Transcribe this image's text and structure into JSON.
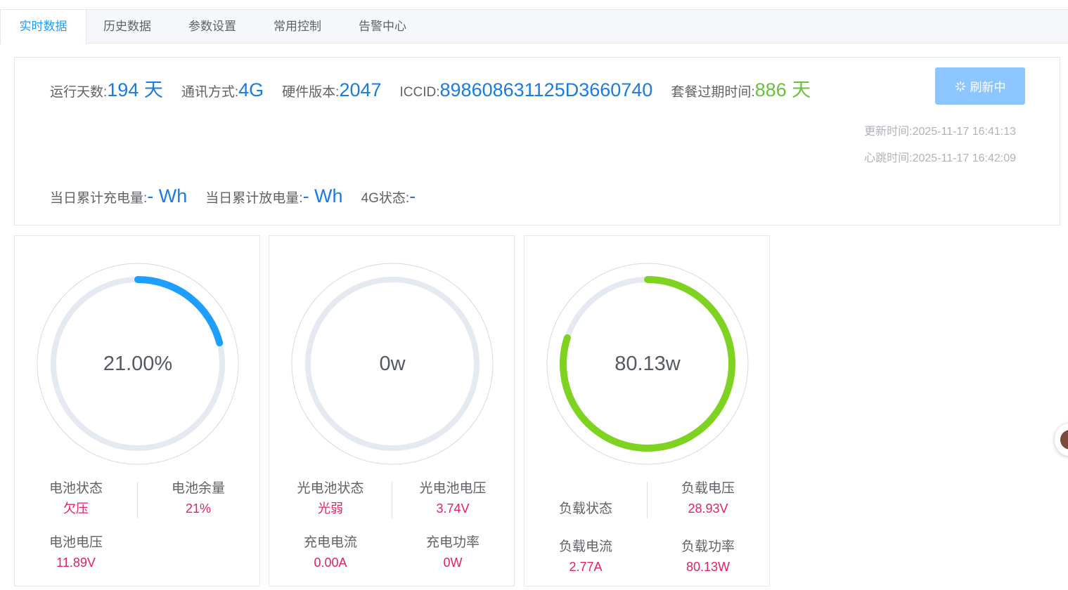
{
  "tabs": [
    {
      "label": "实时数据",
      "active": true
    },
    {
      "label": "历史数据",
      "active": false
    },
    {
      "label": "参数设置",
      "active": false
    },
    {
      "label": "常用控制",
      "active": false
    },
    {
      "label": "告警中心",
      "active": false
    }
  ],
  "info": {
    "run_days_label": "运行天数:",
    "run_days_value": "194 天",
    "comm_label": "通讯方式:",
    "comm_value": "4G",
    "hw_label": "硬件版本:",
    "hw_value": "2047",
    "iccid_label": "ICCID:",
    "iccid_value": "898608631125D3660740",
    "expire_label": "套餐过期时间:",
    "expire_value": "886 天",
    "refresh_label": "刷新中",
    "update_time": "更新时间:2025-11-17 16:41:13",
    "heartbeat_time": "心跳时间:2025-11-17 16:42:09",
    "charge_label": "当日累计充电量:",
    "charge_value": "- Wh",
    "discharge_label": "当日累计放电量:",
    "discharge_value": "- Wh",
    "status4g_label": "4G状态:",
    "status4g_value": "-"
  },
  "colors": {
    "accent_blue": "#1e9fff",
    "battery_arc": "#1e9fff",
    "load_arc": "#7ed321",
    "track": "#e4e9f2",
    "value_red": "#e0245e",
    "green_value": "#67c23a"
  },
  "gauges": [
    {
      "center_text": "21.00%",
      "fraction": 0.21,
      "color": "#1e9fff",
      "stats": [
        {
          "label": "电池状态",
          "value": "欠压"
        },
        {
          "label": "电池余量",
          "value": "21%"
        },
        {
          "label": "电池电压",
          "value": "11.89V"
        }
      ]
    },
    {
      "center_text": "0w",
      "fraction": 0,
      "color": "#1e9fff",
      "stats": [
        {
          "label": "光电池状态",
          "value": "光弱"
        },
        {
          "label": "光电池电压",
          "value": "3.74V"
        },
        {
          "label": "充电电流",
          "value": "0.00A"
        },
        {
          "label": "充电功率",
          "value": "0W"
        }
      ]
    },
    {
      "center_text": "80.13w",
      "fraction": 0.8,
      "color": "#7ed321",
      "stats": [
        {
          "label": "负载状态",
          "value": ""
        },
        {
          "label": "负载电压",
          "value": "28.93V"
        },
        {
          "label": "负载电流",
          "value": "2.77A"
        },
        {
          "label": "负载功率",
          "value": "80.13W"
        }
      ]
    }
  ]
}
